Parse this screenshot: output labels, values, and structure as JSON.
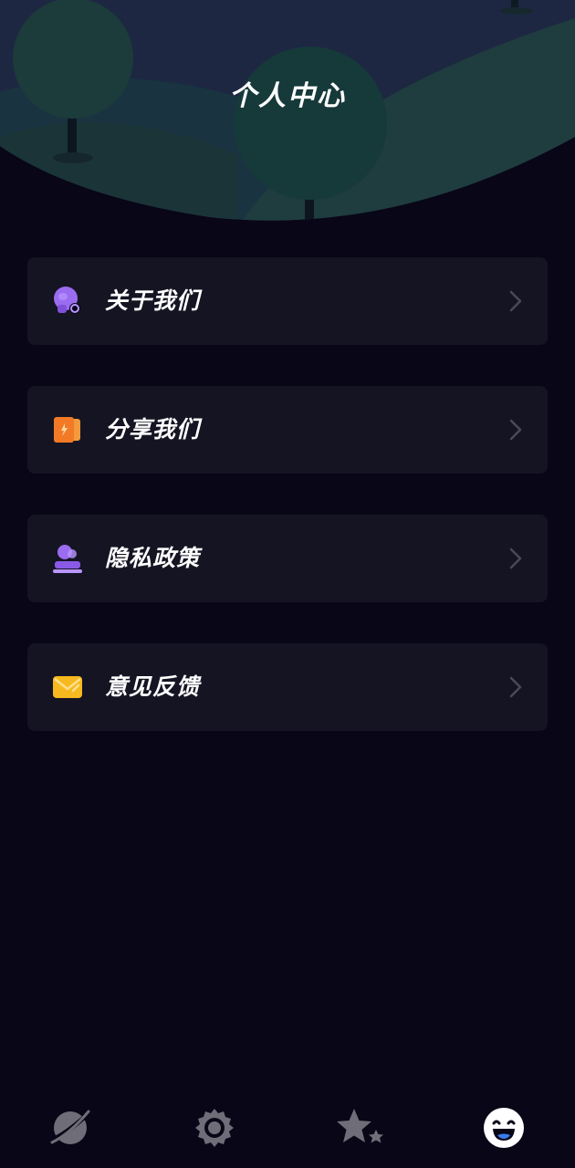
{
  "header": {
    "title": "个人中心"
  },
  "menu": {
    "items": [
      {
        "label": "关于我们",
        "icon": "about-us-icon",
        "color": "#9b6cf0"
      },
      {
        "label": "分享我们",
        "icon": "share-icon",
        "color": "#f27a26"
      },
      {
        "label": "隐私政策",
        "icon": "privacy-policy-icon",
        "color": "#9b6cf0"
      },
      {
        "label": "意见反馈",
        "icon": "feedback-icon",
        "color": "#f6b91f"
      }
    ]
  },
  "nav": {
    "tabs": [
      {
        "icon": "planet-icon",
        "active": false
      },
      {
        "icon": "gear-icon",
        "active": false
      },
      {
        "icon": "star-icon",
        "active": false
      },
      {
        "icon": "smiley-face-icon",
        "active": true
      }
    ]
  },
  "colors": {
    "background": "#080617",
    "card": "#151423",
    "text": "#ffffff",
    "muted_icon": "#6e6d78"
  }
}
